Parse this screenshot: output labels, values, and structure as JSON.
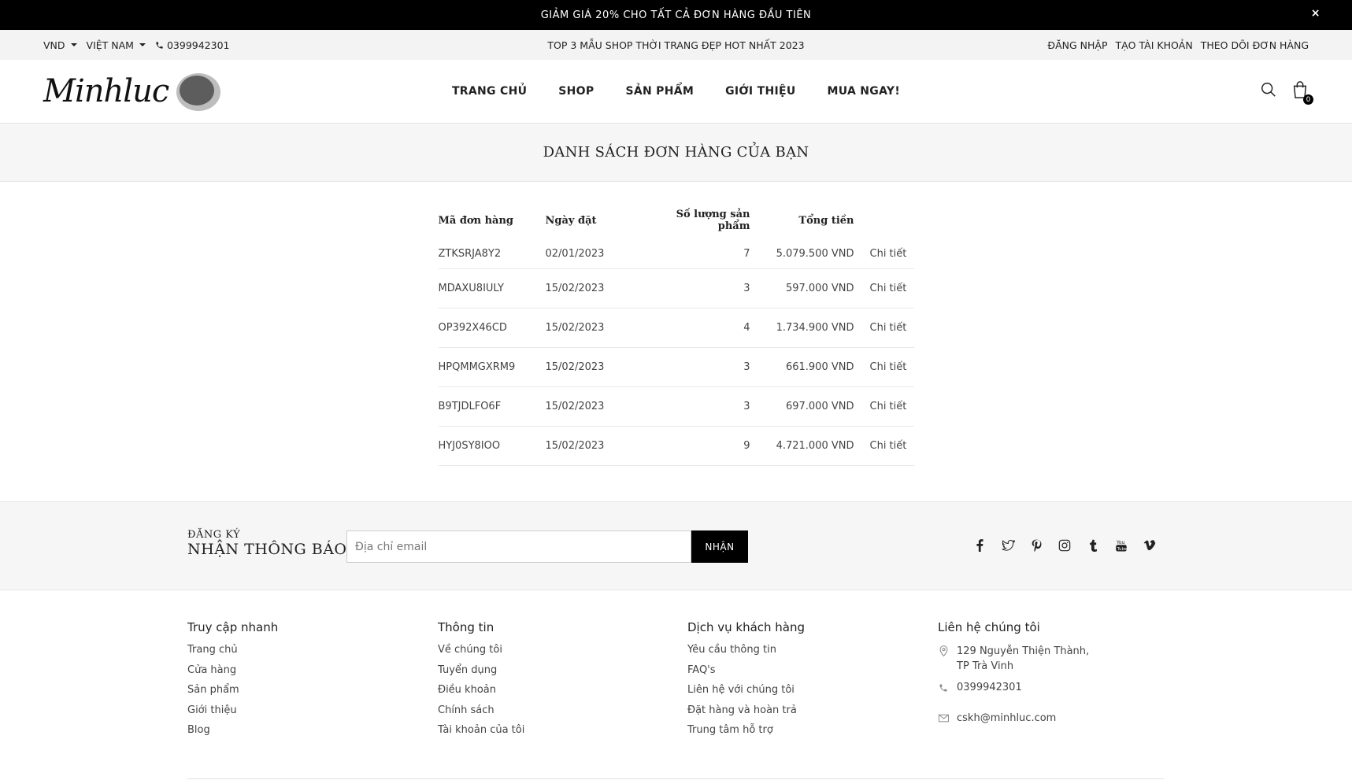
{
  "promo": {
    "text": "GIẢM GIÁ 20% CHO TẤT CẢ ĐƠN HÀNG ĐẦU TIÊN",
    "close": "×"
  },
  "topbar": {
    "currency": "VND",
    "country": "VIỆT NAM",
    "phone": "0399942301",
    "headline": "TOP 3 MẪU SHOP THỜI TRANG ĐẸP HOT NHẤT 2023",
    "links": [
      "ĐĂNG NHẬP",
      "TẠO TÀI KHOẢN",
      "THEO DÕI ĐƠN HÀNG"
    ]
  },
  "header": {
    "logo_text": "Minhluc",
    "nav": [
      "TRANG CHỦ",
      "SHOP",
      "SẢN PHẨM",
      "GIỚI THIỆU",
      "MUA NGAY!"
    ],
    "cart_count": "0"
  },
  "page_title": "DANH SÁCH ĐƠN HÀNG CỦA BẠN",
  "orders": {
    "headers": [
      "Mã đơn hàng",
      "Ngày đặt",
      "Số lượng sản phẩm",
      "Tổng tiền"
    ],
    "rows": [
      {
        "code": "ZTKSRJA8Y2",
        "date": "02/01/2023",
        "qty": "7",
        "total": "5.079.500 VND",
        "action": "Chi tiết"
      },
      {
        "code": "MDAXU8IULY",
        "date": "15/02/2023",
        "qty": "3",
        "total": "597.000 VND",
        "action": "Chi tiết"
      },
      {
        "code": "OP392X46CD",
        "date": "15/02/2023",
        "qty": "4",
        "total": "1.734.900 VND",
        "action": "Chi tiết"
      },
      {
        "code": "HPQMMGXRM9",
        "date": "15/02/2023",
        "qty": "3",
        "total": "661.900 VND",
        "action": "Chi tiết"
      },
      {
        "code": "B9TJDLFO6F",
        "date": "15/02/2023",
        "qty": "3",
        "total": "697.000 VND",
        "action": "Chi tiết"
      },
      {
        "code": "HYJ0SY8IOO",
        "date": "15/02/2023",
        "qty": "9",
        "total": "4.721.000 VND",
        "action": "Chi tiết"
      }
    ]
  },
  "newsletter": {
    "label_small": "ĐĂNG KÝ",
    "label_big": "NHẬN THÔNG BÁO",
    "placeholder": "Địa chỉ email",
    "button": "NHẬN",
    "social": [
      "facebook-icon",
      "twitter-icon",
      "pinterest-icon",
      "instagram-icon",
      "tumblr-icon",
      "youtube-icon",
      "vimeo-icon"
    ]
  },
  "footer": {
    "quick": {
      "title": "Truy cập nhanh",
      "items": [
        "Trang chủ",
        "Cửa hàng",
        "Sản phẩm",
        "Giới thiệu",
        "Blog"
      ]
    },
    "info": {
      "title": "Thông tin",
      "items": [
        "Về chúng tôi",
        "Tuyển dụng",
        "Điều khoản",
        "Chính sách",
        "Tài khoản của tôi"
      ]
    },
    "service": {
      "title": "Dịch vụ khách hàng",
      "items": [
        "Yêu cầu thông tin",
        "FAQ's",
        "Liên hệ với chúng tôi",
        "Đặt hàng và hoàn trả",
        "Trung tâm hỗ trợ"
      ]
    },
    "contact": {
      "title": "Liên hệ chúng tôi",
      "address_line1": "129 Nguyễn Thiện Thành,",
      "address_line2": "TP Trà Vinh",
      "phone": "0399942301",
      "email": "cskh@minhluc.com"
    }
  }
}
